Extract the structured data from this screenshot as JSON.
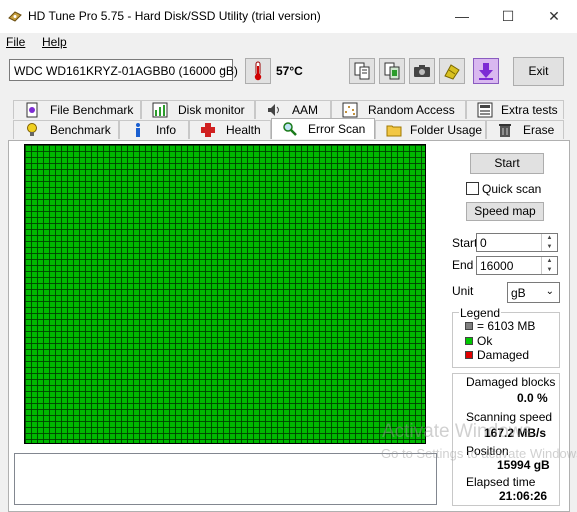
{
  "window": {
    "title": "HD Tune Pro 5.75 - Hard Disk/SSD Utility (trial version)",
    "minimize_glyph": "—",
    "maximize_glyph": "☐",
    "close_glyph": "✕"
  },
  "menu": {
    "file": "File",
    "help": "Help"
  },
  "toolbar": {
    "drive": "WDC WD161KRYZ-01AGBB0 (16000 gB)",
    "temperature": "57°C",
    "exit_label": "Exit",
    "icons": [
      "copy-text-icon",
      "copy-info-icon",
      "screenshot-icon",
      "options-icon",
      "save-icon"
    ]
  },
  "tabs_top": [
    "File Benchmark",
    "Disk monitor",
    "AAM",
    "Random Access",
    "Extra tests"
  ],
  "tabs_bottom": [
    "Benchmark",
    "Info",
    "Health",
    "Error Scan",
    "Folder Usage",
    "Erase"
  ],
  "active_tab": "Error Scan",
  "scan": {
    "start_button": "Start",
    "quick_scan_label": "Quick scan",
    "quick_scan_checked": false,
    "speed_map_button": "Speed map",
    "start_label": "Start",
    "start_value": "0",
    "end_label": "End",
    "end_value": "16000",
    "unit_label": "Unit",
    "unit_value": "gB",
    "grid_color": "#00b800"
  },
  "legend": {
    "title": "Legend",
    "block_size": "= 6103 MB",
    "ok": "Ok",
    "damaged": "Damaged",
    "colors": {
      "block": "#808080",
      "ok": "#00c800",
      "damaged": "#e00000"
    }
  },
  "stats": {
    "damaged_blocks_label": "Damaged blocks",
    "damaged_blocks_value": "0.0 %",
    "scanning_speed_label": "Scanning speed",
    "scanning_speed_value": "167.2 MB/s",
    "position_label": "Position",
    "position_value": "15994 gB",
    "elapsed_label": "Elapsed time",
    "elapsed_value": "21:06:26"
  },
  "watermark": {
    "line1": "Activate Windows",
    "line2": "Go to Settings to activate Windows."
  }
}
